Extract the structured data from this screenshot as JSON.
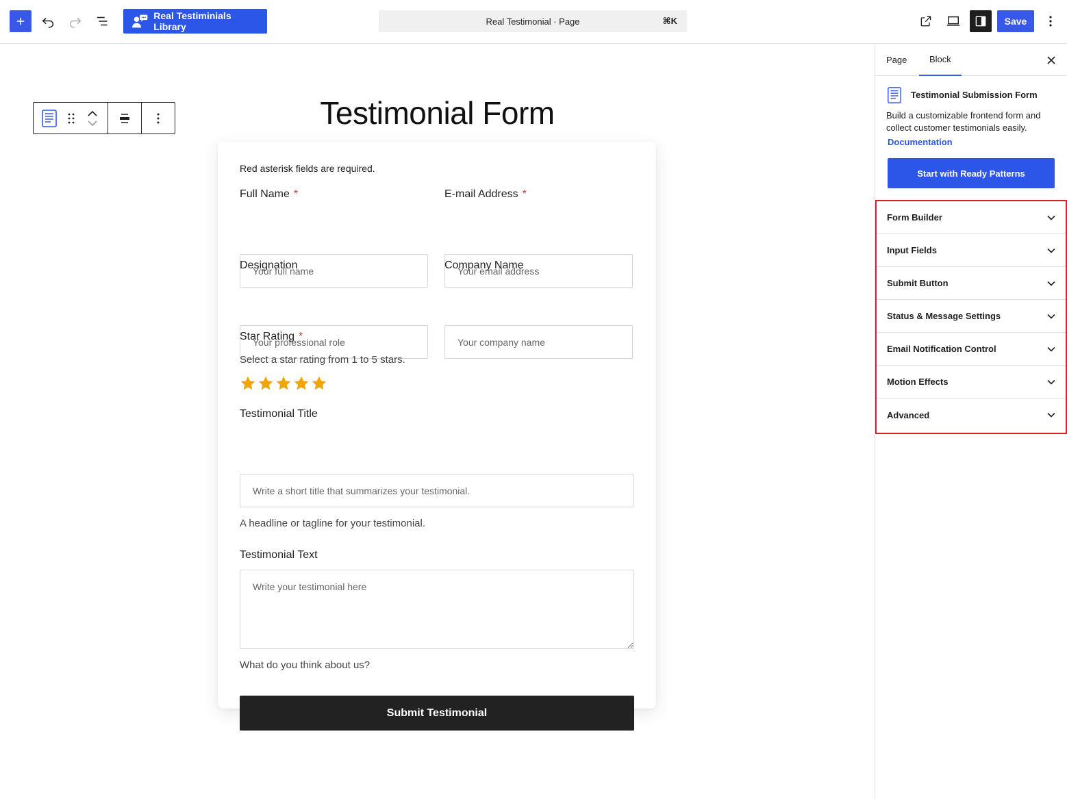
{
  "toolbar": {
    "library_label": "Real Testiminials Library",
    "command_title": "Real Testimonial · Page",
    "command_shortcut": "⌘K",
    "save_label": "Save"
  },
  "canvas": {
    "page_title": "Testimonial Form",
    "form": {
      "required_note": "Red asterisk fields are required.",
      "full_name": {
        "label": "Full Name",
        "required_mark": "*",
        "placeholder": "Your full name"
      },
      "email": {
        "label": "E-mail Address",
        "required_mark": "*",
        "placeholder": "Your email address"
      },
      "designation": {
        "label": "Designation",
        "placeholder": "Your professional role"
      },
      "company": {
        "label": "Company Name",
        "placeholder": "Your company name"
      },
      "rating": {
        "label": "Star Rating",
        "required_mark": "*",
        "help": "Select a star rating from 1 to 5 stars.",
        "value": 5,
        "max": 5,
        "star_color": "#f0a500"
      },
      "title": {
        "label": "Testimonial Title",
        "placeholder": "Write a short title that summarizes your testimonial.",
        "help": "A headline or tagline for your testimonial."
      },
      "text": {
        "label": "Testimonial Text",
        "placeholder": "Write your testimonial here",
        "help": "What do you think about us?"
      },
      "submit_label": "Submit Testimonial"
    }
  },
  "sidebar": {
    "tabs": [
      {
        "label": "Page",
        "active": false
      },
      {
        "label": "Block",
        "active": true
      }
    ],
    "block": {
      "name": "Testimonial Submission Form",
      "description": "Build a customizable frontend form and collect customer testimonials easily.",
      "doc_link": "Documentation",
      "patterns_button": "Start with Ready Patterns"
    },
    "panels": [
      {
        "label": "Form Builder"
      },
      {
        "label": "Input Fields"
      },
      {
        "label": "Submit Button"
      },
      {
        "label": "Status & Message Settings"
      },
      {
        "label": "Email Notification Control"
      },
      {
        "label": "Motion Effects"
      },
      {
        "label": "Advanced"
      }
    ]
  },
  "colors": {
    "accent": "#3858e9",
    "library_button": "#2b56e8",
    "highlight_outline": "#d7202a",
    "required_asterisk": "#d63638"
  }
}
